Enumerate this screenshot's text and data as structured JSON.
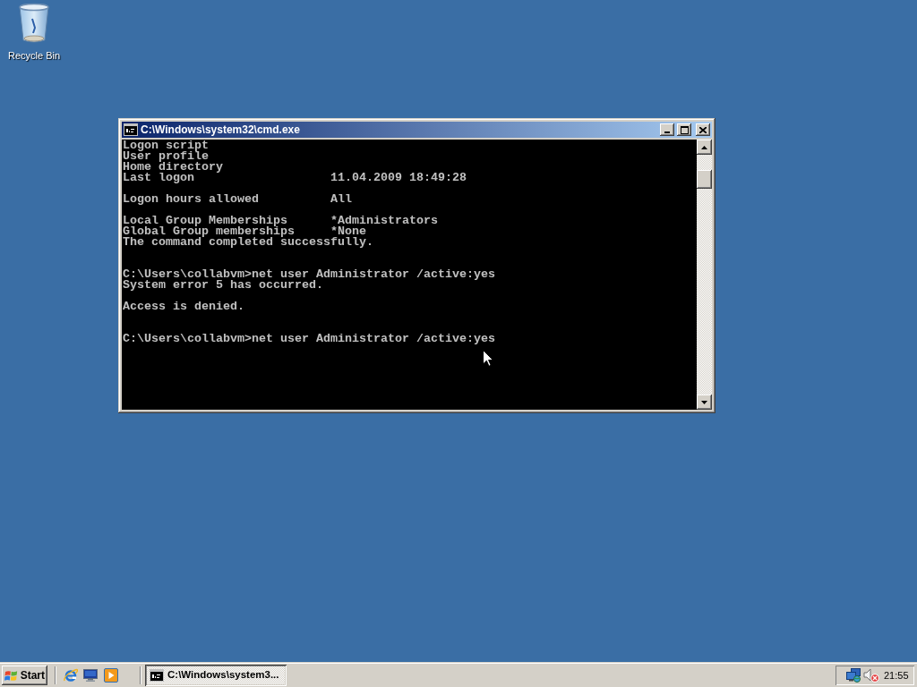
{
  "desktop": {
    "icons": [
      {
        "label": "Recycle Bin"
      }
    ]
  },
  "window": {
    "title": "C:\\Windows\\system32\\cmd.exe",
    "active": true,
    "console_lines": [
      {
        "kind": "text",
        "text": "Logon script"
      },
      {
        "kind": "text",
        "text": "User profile"
      },
      {
        "kind": "text",
        "text": "Home directory"
      },
      {
        "kind": "text",
        "text": "Last logon                   11.04.2009 18:49:28"
      },
      {
        "kind": "blank"
      },
      {
        "kind": "text",
        "text": "Logon hours allowed          All"
      },
      {
        "kind": "blank"
      },
      {
        "kind": "text",
        "text": "Local Group Memberships      *Administrators"
      },
      {
        "kind": "text",
        "text": "Global Group memberships     *None"
      },
      {
        "kind": "text",
        "text": "The command completed successfully."
      },
      {
        "kind": "blank"
      },
      {
        "kind": "blank"
      },
      {
        "kind": "text",
        "text": "C:\\Users\\collabvm>net user Administrator /active:yes"
      },
      {
        "kind": "text",
        "text": "System error 5 has occurred."
      },
      {
        "kind": "blank"
      },
      {
        "kind": "text",
        "text": "Access is denied."
      },
      {
        "kind": "blank"
      },
      {
        "kind": "blank"
      },
      {
        "kind": "text",
        "text": "C:\\Users\\collabvm>net user Administrator /active:yes"
      }
    ]
  },
  "taskbar": {
    "start_label": "Start",
    "tasks": [
      {
        "label": "C:\\Windows\\system3...",
        "selected": true
      }
    ],
    "clock": "21:55"
  }
}
